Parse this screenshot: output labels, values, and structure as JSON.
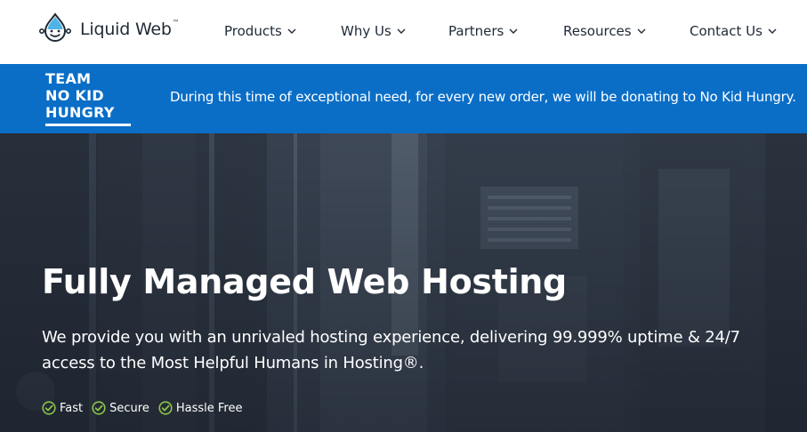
{
  "header": {
    "logo_text": "Liquid Web",
    "logo_tm": "™",
    "nav": [
      {
        "label": "Products"
      },
      {
        "label": "Why Us"
      },
      {
        "label": "Partners"
      },
      {
        "label": "Resources"
      },
      {
        "label": "Contact Us"
      }
    ]
  },
  "banner": {
    "badge_lines": [
      "TEAM",
      "NO KID",
      "HUNGRY"
    ],
    "message": "During this time of exceptional need, for every new order, we will be donating to No Kid Hungry."
  },
  "hero": {
    "title": "Fully Managed Web Hosting",
    "subtitle": "We provide you with an unrivaled hosting experience, delivering 99.999% uptime & 24/7 access to the Most Helpful Humans in Hosting®.",
    "features": [
      {
        "label": "Fast",
        "icon": "check-circle-icon"
      },
      {
        "label": "Secure",
        "icon": "check-circle-icon"
      },
      {
        "label": "Hassle Free",
        "icon": "check-circle-icon"
      }
    ]
  },
  "colors": {
    "banner_blue": "#0a6ec7",
    "text_dark": "#1f2a36",
    "check_green": "#8bc34a"
  }
}
